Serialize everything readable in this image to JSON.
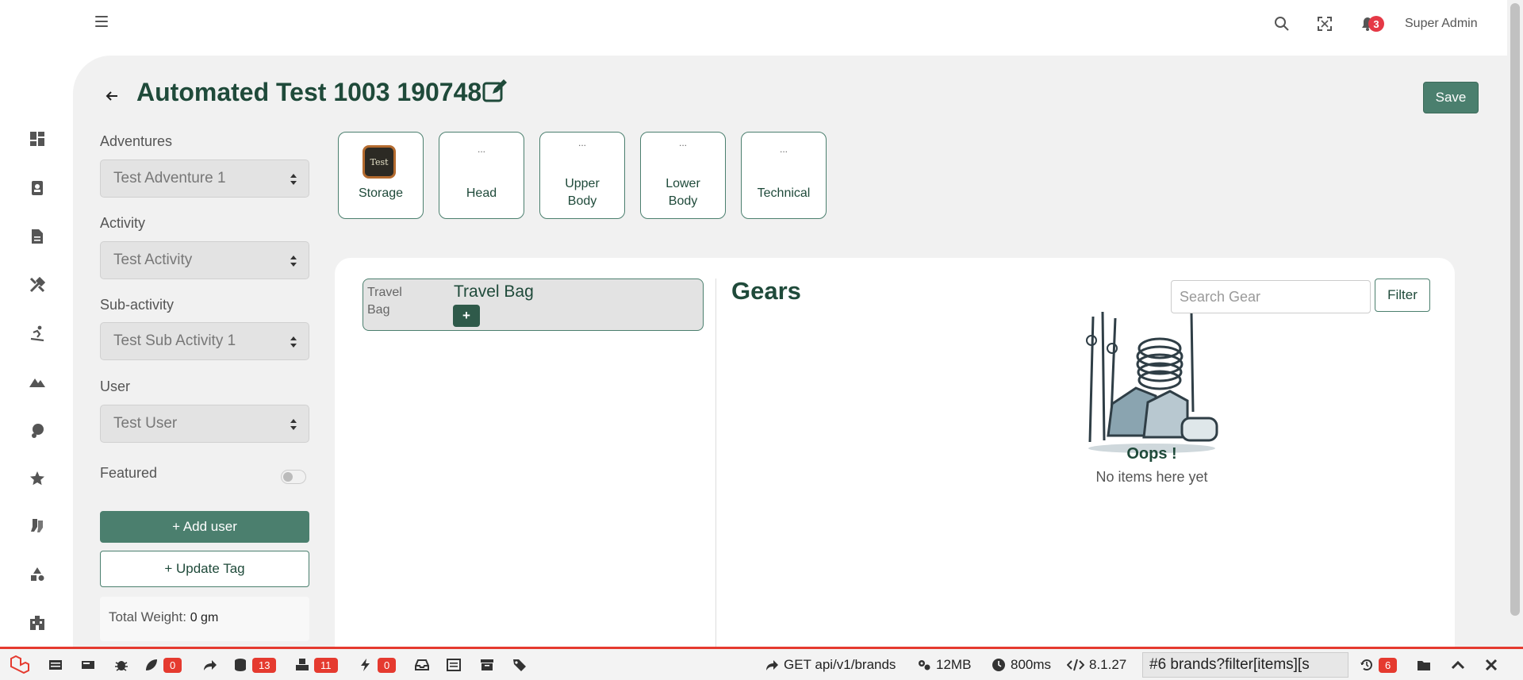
{
  "topbar": {
    "user_name": "Super Admin",
    "notification_count": "3"
  },
  "page": {
    "title": "Automated Test 1003 190748",
    "save_label": "Save"
  },
  "form": {
    "adventures": {
      "label": "Adventures",
      "value": "Test Adventure 1"
    },
    "activity": {
      "label": "Activity",
      "value": "Test Activity"
    },
    "sub_activity": {
      "label": "Sub-activity",
      "value": "Test Sub Activity 1"
    },
    "user": {
      "label": "User",
      "value": "Test User"
    },
    "featured": {
      "label": "Featured",
      "enabled": false
    },
    "add_user_label": "+ Add user",
    "update_tag_label": "+ Update Tag",
    "total_weight_label": "Total Weight:",
    "total_weight_value": "0 gm"
  },
  "categories": [
    {
      "label": "Storage",
      "image_text": "Test"
    },
    {
      "label": "Head",
      "image_text": "..."
    },
    {
      "label": "Upper Body",
      "image_text": "..."
    },
    {
      "label": "Lower Body",
      "image_text": "..."
    },
    {
      "label": "Technical",
      "image_text": "..."
    }
  ],
  "bag": {
    "image_alt": "Travel Bag",
    "name": "Travel Bag",
    "add_label": "+"
  },
  "gears": {
    "title": "Gears",
    "search_placeholder": "Search Gear",
    "filter_label": "Filter",
    "empty_title": "Oops !",
    "empty_message": "No items here yet"
  },
  "devbar": {
    "badges": [
      "0",
      "13",
      "11",
      "0"
    ],
    "route": "GET api/v1/brands",
    "memory": "12MB",
    "time": "800ms",
    "version": "8.1.27",
    "request_select": "#6 brands?filter[items][s",
    "history_count": "6",
    "accent": "#e53a2f"
  },
  "colors": {
    "brand": "#4b7f6e",
    "text": "#1f4a3a",
    "danger": "#e53946"
  }
}
